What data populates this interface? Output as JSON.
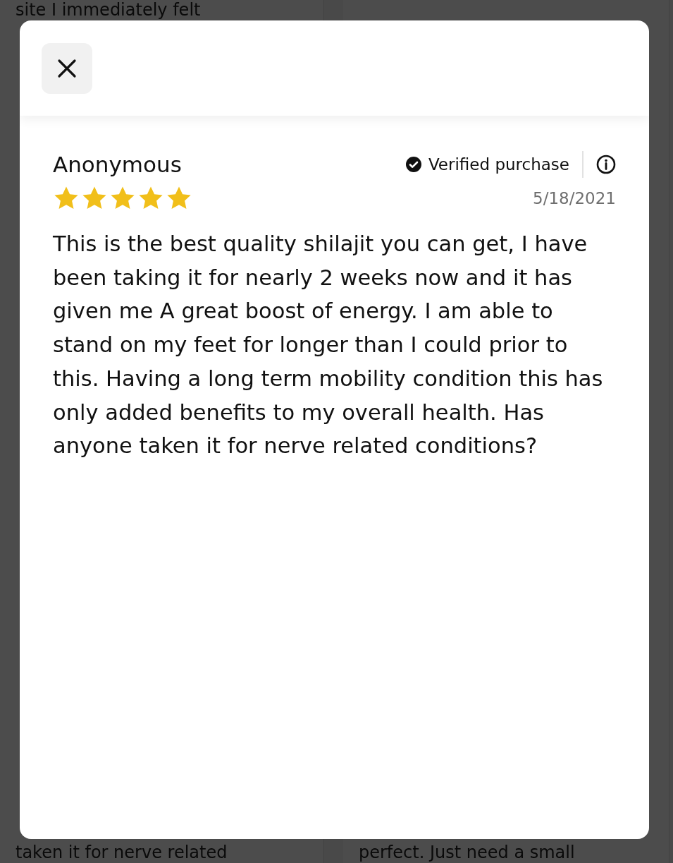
{
  "background": {
    "left_column": {
      "top_text": "site I  immediately felt",
      "bottom_text": "taken it for nerve related"
    },
    "right_column": {
      "bottom_text": "perfect. Just need a small"
    }
  },
  "review": {
    "author": "Anonymous",
    "verified_label": "Verified purchase",
    "verified": true,
    "stars": 5,
    "date": "5/18/2021",
    "text": "This is the best quality shilajit you can get, I have been taking it for nearly 2 weeks now and it has given me A great boost of energy. I am able to stand on my feet for longer than I could prior to this. Having a long term mobility condition this has only added benefits to my overall health. Has anyone taken it for nerve related conditions?"
  }
}
